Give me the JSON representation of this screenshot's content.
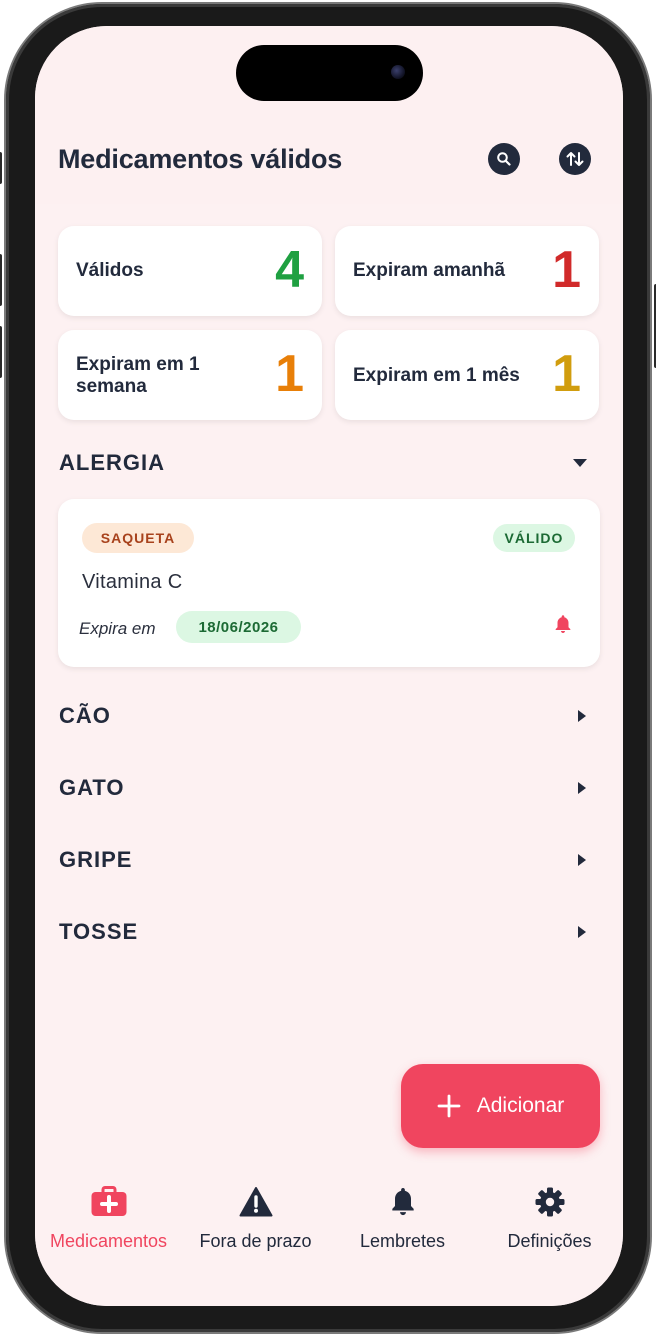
{
  "header": {
    "title": "Medicamentos válidos"
  },
  "stats": [
    {
      "label": "Válidos",
      "value": "4",
      "color": "#1fa041"
    },
    {
      "label": "Expiram amanhã",
      "value": "1",
      "color": "#d12a2a"
    },
    {
      "label": "Expiram em 1 semana",
      "value": "1",
      "color": "#e87f08"
    },
    {
      "label": "Expiram em 1 mês",
      "value": "1",
      "color": "#d19d0e"
    }
  ],
  "groups": [
    {
      "name": "ALERGIA",
      "expanded": true
    },
    {
      "name": "CÃO",
      "expanded": false
    },
    {
      "name": "GATO",
      "expanded": false
    },
    {
      "name": "GRIPE",
      "expanded": false
    },
    {
      "name": "TOSSE",
      "expanded": false
    }
  ],
  "medication": {
    "type": "SAQUETA",
    "status": "VÁLIDO",
    "name": "Vitamina C",
    "expires_label": "Expira em",
    "expiry_date": "18/06/2026"
  },
  "fab": {
    "label": "Adicionar"
  },
  "nav": {
    "items": [
      {
        "label": "Medicamentos",
        "active": true
      },
      {
        "label": "Fora de prazo",
        "active": false
      },
      {
        "label": "Lembretes",
        "active": false
      },
      {
        "label": "Definições",
        "active": false
      }
    ]
  },
  "colors": {
    "accent": "#f0455f",
    "text": "#222a3c",
    "background": "#fdf1f2",
    "type_pill_bg": "#fde8d6",
    "type_pill_text": "#a8421c",
    "valid_pill_bg": "#dcf7e3",
    "valid_pill_text": "#1c6a34"
  }
}
